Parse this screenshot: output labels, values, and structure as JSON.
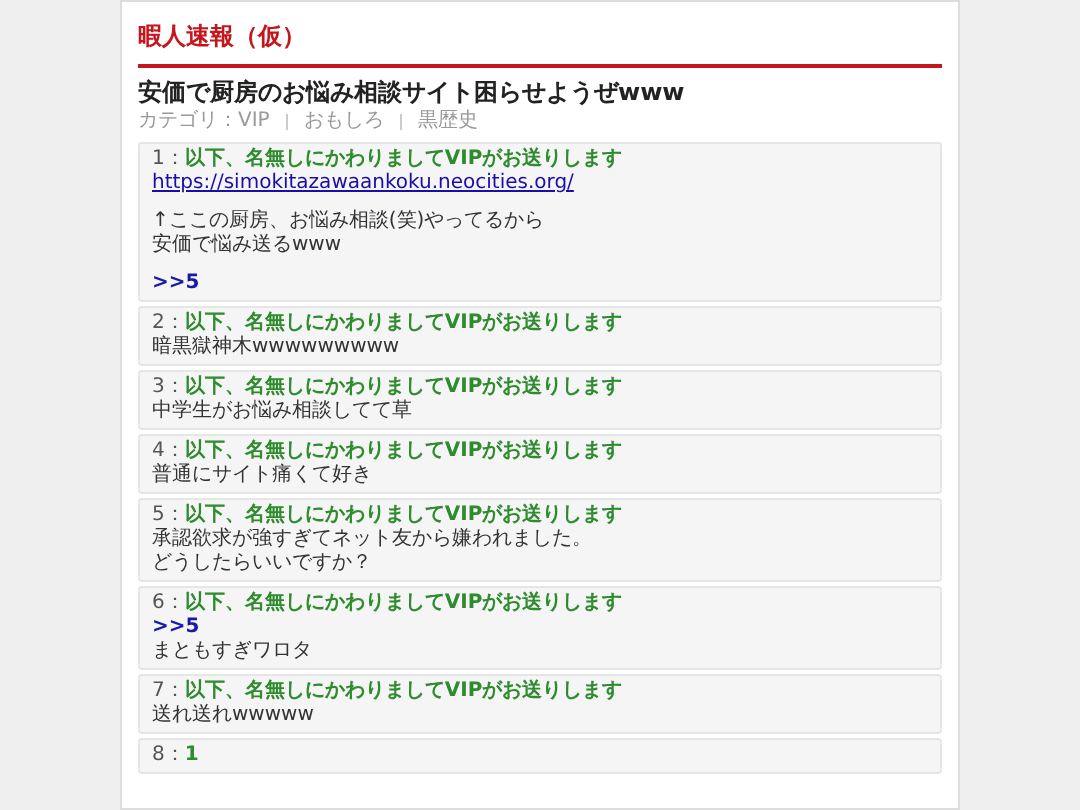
{
  "site_title": "暇人速報（仮）",
  "article": {
    "title": "安価で厨房のお悩み相談サイト困らせようぜwww",
    "meta": [
      "カテゴリ：VIP",
      "おもしろ",
      "黒歴史"
    ]
  },
  "posts": [
    {
      "number": "1：",
      "name": "以下、名無しにかわりましてVIPがお送りします",
      "paragraphs": [
        [
          {
            "kind": "link",
            "text": "https://simokitazawaankoku.neocities.org/"
          }
        ],
        [
          {
            "kind": "text",
            "text": "↑ここの厨房、お悩み相談(笑)やってるから"
          },
          {
            "kind": "text",
            "text": "安価で悩み送るwww"
          }
        ],
        [
          {
            "kind": "anchor",
            "text": ">>5"
          }
        ]
      ]
    },
    {
      "number": "2：",
      "name": "以下、名無しにかわりましてVIPがお送りします",
      "paragraphs": [
        [
          {
            "kind": "text",
            "text": "暗黒獄神木wwwwwwwww"
          }
        ]
      ]
    },
    {
      "number": "3：",
      "name": "以下、名無しにかわりましてVIPがお送りします",
      "paragraphs": [
        [
          {
            "kind": "text",
            "text": "中学生がお悩み相談してて草"
          }
        ]
      ]
    },
    {
      "number": "4：",
      "name": "以下、名無しにかわりましてVIPがお送りします",
      "paragraphs": [
        [
          {
            "kind": "text",
            "text": "普通にサイト痛くて好き"
          }
        ]
      ]
    },
    {
      "number": "5：",
      "name": "以下、名無しにかわりましてVIPがお送りします",
      "paragraphs": [
        [
          {
            "kind": "text",
            "text": "承認欲求が強すぎてネット友から嫌われました。"
          },
          {
            "kind": "text",
            "text": "どうしたらいいですか？"
          }
        ]
      ]
    },
    {
      "number": "6：",
      "name": "以下、名無しにかわりましてVIPがお送りします",
      "paragraphs": [
        [
          {
            "kind": "anchor",
            "text": ">>5"
          },
          {
            "kind": "text",
            "text": "まともすぎワロタ"
          }
        ]
      ]
    },
    {
      "number": "7：",
      "name": "以下、名無しにかわりましてVIPがお送りします",
      "paragraphs": [
        [
          {
            "kind": "text",
            "text": "送れ送れwwwww"
          }
        ]
      ]
    },
    {
      "number": "8：",
      "name": "1"
    }
  ]
}
